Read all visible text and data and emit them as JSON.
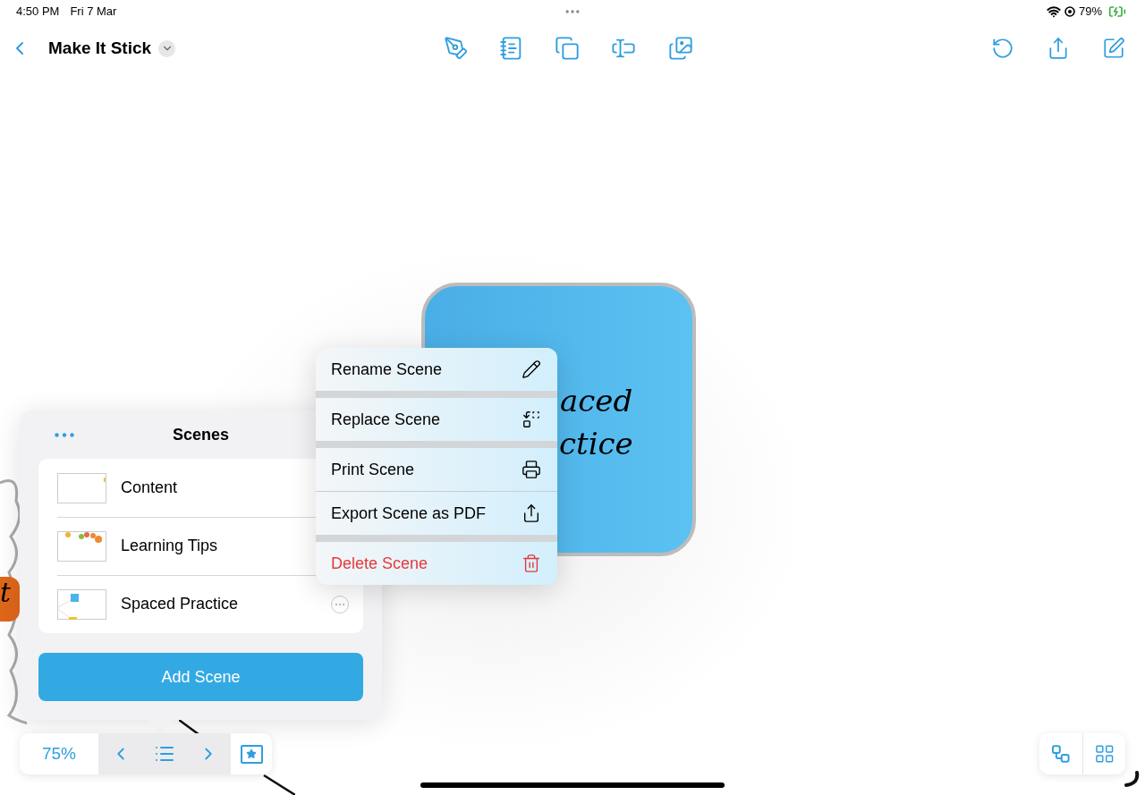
{
  "status_bar": {
    "time": "4:50 PM",
    "date": "Fri 7 Mar",
    "battery": "79%"
  },
  "toolbar": {
    "title": "Make It Stick"
  },
  "canvas": {
    "note_lines": [
      "aced",
      "ctice"
    ],
    "fragment": "t"
  },
  "context_menu": [
    {
      "label": "Rename Scene",
      "kind": "normal",
      "gap_before": false
    },
    {
      "label": "Replace Scene",
      "kind": "normal",
      "gap_before": true
    },
    {
      "label": "Print Scene",
      "kind": "normal",
      "gap_before": true
    },
    {
      "label": "Export Scene as PDF",
      "kind": "normal",
      "gap_before": false
    },
    {
      "label": "Delete Scene",
      "kind": "destructive",
      "gap_before": true
    }
  ],
  "scenes_panel": {
    "title": "Scenes",
    "scenes": [
      {
        "name": "Content"
      },
      {
        "name": "Learning Tips"
      },
      {
        "name": "Spaced Practice"
      }
    ],
    "add_button": "Add Scene"
  },
  "bottom_bar": {
    "zoom": "75%"
  }
}
